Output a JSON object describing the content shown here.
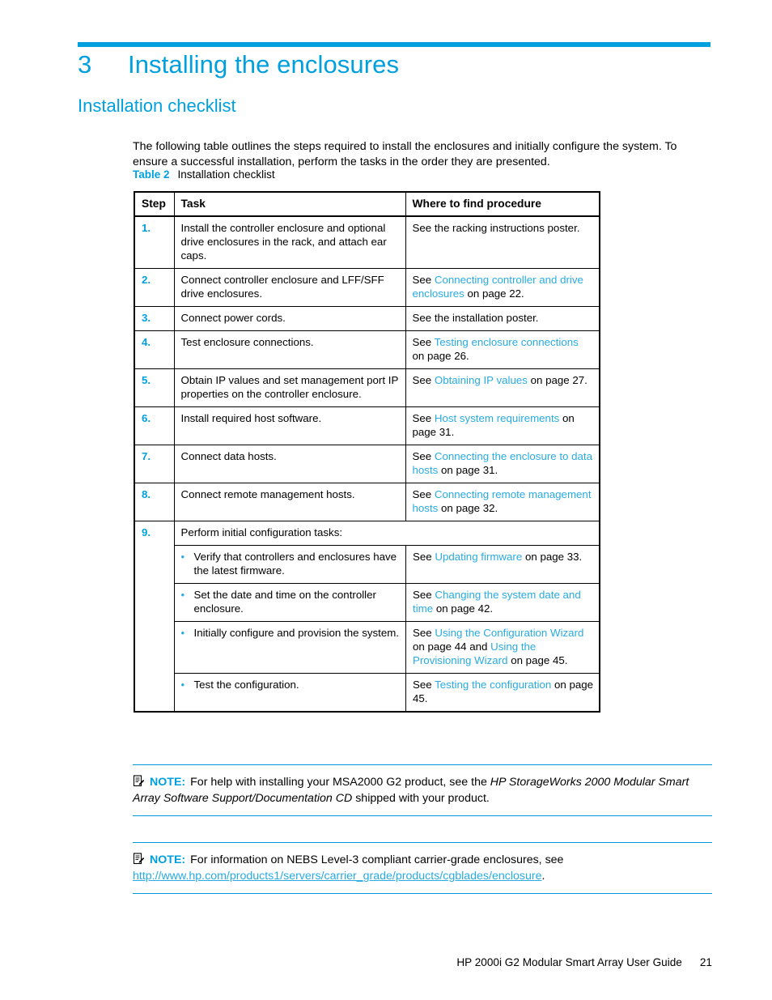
{
  "chapter": {
    "number": "3",
    "title": "Installing the enclosures"
  },
  "section": {
    "title": "Installation checklist"
  },
  "intro": "The following table outlines the steps required to install the enclosures and initially configure the system. To ensure a successful installation, perform the tasks in the order they are presented.",
  "table_caption": {
    "label": "Table 2",
    "text": "Installation checklist"
  },
  "table": {
    "headers": {
      "step": "Step",
      "task": "Task",
      "where": "Where to find procedure"
    },
    "rows": [
      {
        "step": "1.",
        "task": "Install the controller enclosure and optional drive enclosures in the rack, and attach ear caps.",
        "where_pre": "See the racking instructions poster.",
        "where_link": "",
        "where_post": ""
      },
      {
        "step": "2.",
        "task": "Connect controller enclosure and LFF/SFF drive enclosures.",
        "where_pre": "See ",
        "where_link": "Connecting controller and drive enclosures",
        "where_post": " on page 22."
      },
      {
        "step": "3.",
        "task": "Connect power cords.",
        "where_pre": "See the installation poster.",
        "where_link": "",
        "where_post": ""
      },
      {
        "step": "4.",
        "task": "Test enclosure connections.",
        "where_pre": "See ",
        "where_link": "Testing enclosure connections",
        "where_post": " on page 26."
      },
      {
        "step": "5.",
        "task": "Obtain IP values and set management port IP properties on the controller enclosure.",
        "where_pre": "See ",
        "where_link": "Obtaining IP values",
        "where_post": " on page 27."
      },
      {
        "step": "6.",
        "task": "Install required host software.",
        "where_pre": "See ",
        "where_link": "Host system requirements",
        "where_post": " on page 31."
      },
      {
        "step": "7.",
        "task": "Connect data hosts.",
        "where_pre": "See ",
        "where_link": "Connecting the enclosure to data hosts",
        "where_post": " on page 31."
      },
      {
        "step": "8.",
        "task": "Connect remote management hosts.",
        "where_pre": "See ",
        "where_link": "Connecting remote management hosts",
        "where_post": " on page 32."
      }
    ],
    "row9": {
      "step": "9.",
      "heading": "Perform initial configuration tasks:",
      "bullet": "•",
      "subrows": [
        {
          "task": "Verify that controllers and enclosures have the latest firmware.",
          "where_pre": "See ",
          "where_link": "Updating firmware",
          "where_post": " on page 33."
        },
        {
          "task": "Set the date and time on the controller enclosure.",
          "where_pre": "See ",
          "where_link": "Changing the system date and time",
          "where_post": " on page 42."
        },
        {
          "task": "Initially configure and provision the system.",
          "where_pre": "See ",
          "where_link": "Using the Configuration Wizard",
          "where_mid": " on page 44 and ",
          "where_link2": "Using the Provisioning Wizard",
          "where_post": " on page 45."
        },
        {
          "task": "Test the configuration.",
          "where_pre": "See ",
          "where_link": "Testing the configuration",
          "where_post": " on page 45."
        }
      ]
    }
  },
  "notes": [
    {
      "keyword": "NOTE:",
      "text_1": "For help with installing your MSA2000 G2 product, see the ",
      "italic_1": "HP StorageWorks 2000 Modular Smart Array Software Support/Documentation CD",
      "text_2": " shipped with your product."
    },
    {
      "keyword": "NOTE:",
      "text_1": "For information on NEBS Level-3 compliant carrier-grade enclosures, see ",
      "url": "http://www.hp.com/products1/servers/carrier_grade/products/cgblades/enclosure",
      "text_2": "."
    }
  ],
  "footer": {
    "title": "HP 2000i G2 Modular Smart Array User Guide",
    "page": "21"
  },
  "colors": {
    "accent": "#00a0df",
    "link": "#29abe2",
    "rule": "#0099da",
    "text": "#000000"
  }
}
